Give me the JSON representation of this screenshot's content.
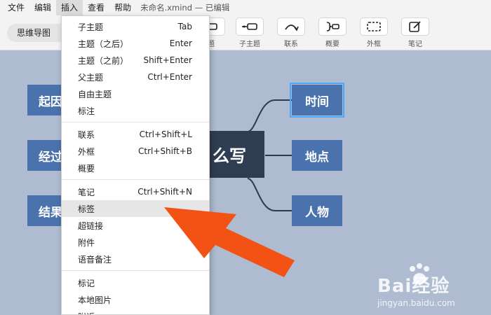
{
  "menubar": {
    "items": [
      "文件",
      "编辑",
      "插入",
      "查看",
      "帮助"
    ],
    "window_title": "未命名.xmind — 已编辑"
  },
  "toolbar": {
    "mode": "思维导图",
    "tools": [
      "题",
      "子主题",
      "联系",
      "概要",
      "外框",
      "笔记"
    ]
  },
  "menu": {
    "groups": [
      [
        {
          "label": "子主题",
          "shortcut": "Tab"
        },
        {
          "label": "主题（之后）",
          "shortcut": "Enter"
        },
        {
          "label": "主题（之前）",
          "shortcut": "Shift+Enter"
        },
        {
          "label": "父主题",
          "shortcut": "Ctrl+Enter"
        },
        {
          "label": "自由主题",
          "shortcut": ""
        },
        {
          "label": "标注",
          "shortcut": ""
        }
      ],
      [
        {
          "label": "联系",
          "shortcut": "Ctrl+Shift+L"
        },
        {
          "label": "外框",
          "shortcut": "Ctrl+Shift+B"
        },
        {
          "label": "概要",
          "shortcut": ""
        }
      ],
      [
        {
          "label": "笔记",
          "shortcut": "Ctrl+Shift+N"
        },
        {
          "label": "标签",
          "shortcut": ""
        },
        {
          "label": "超链接",
          "shortcut": ""
        },
        {
          "label": "附件",
          "shortcut": ""
        },
        {
          "label": "语音备注",
          "shortcut": ""
        }
      ],
      [
        {
          "label": "标记",
          "shortcut": ""
        },
        {
          "label": "本地图片",
          "shortcut": ""
        },
        {
          "label": "附近",
          "shortcut": ""
        }
      ]
    ],
    "hovered": "标签"
  },
  "mindmap": {
    "central": "么写",
    "left_nodes": [
      "起因",
      "经过",
      "结果"
    ],
    "right_nodes": [
      "时间",
      "地点",
      "人物"
    ],
    "selected": "时间"
  },
  "watermark": {
    "brand": "Bai经验",
    "url": "jingyan.baidu.com"
  },
  "colors": {
    "canvas": "#aebbd1",
    "topic": "#4a72ad",
    "central": "#2f3d52",
    "arrow": "#f25314",
    "selection": "#4aa8ff"
  }
}
